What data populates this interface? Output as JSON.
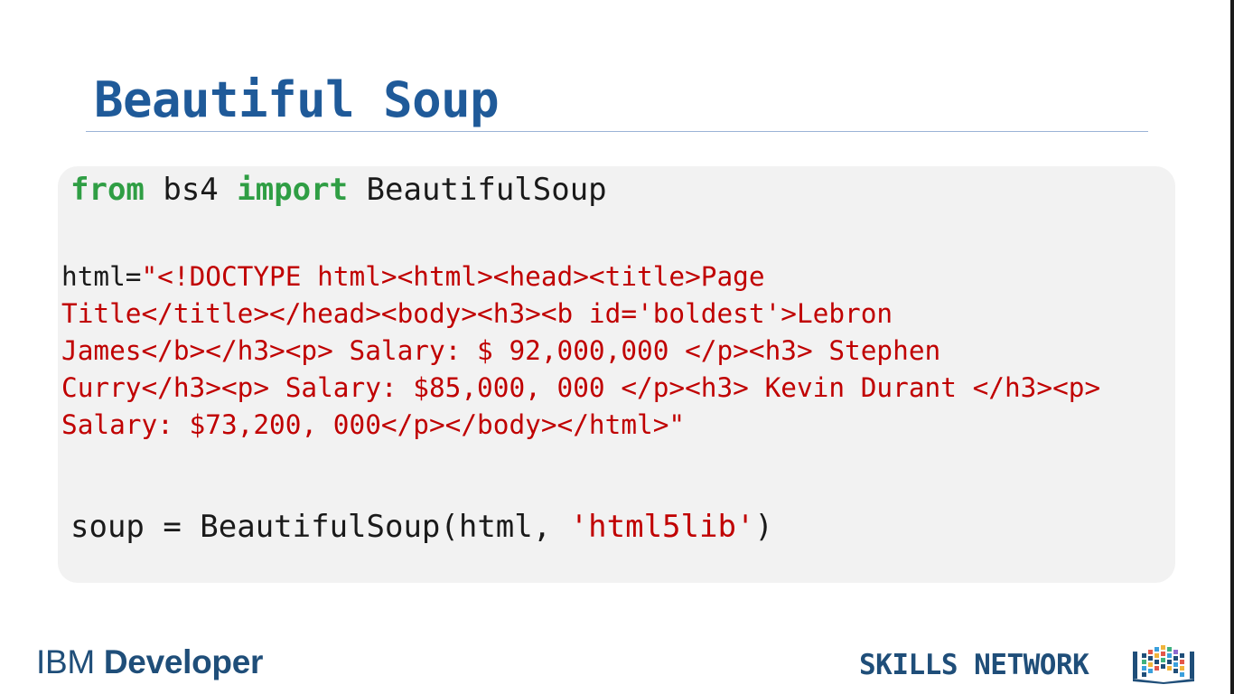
{
  "slide": {
    "title": "Beautiful Soup"
  },
  "code": {
    "import_line": {
      "kw_from": "from",
      "module": " bs4 ",
      "kw_import": "import",
      "name": " BeautifulSoup"
    },
    "html_assignment": {
      "prefix": "html=",
      "lines": [
        "\"<!DOCTYPE html><html><head><title>Page",
        "Title</title></head><body><h3><b id='boldest'>Lebron",
        "James</b></h3><p> Salary: $ 92,000,000 </p><h3> Stephen",
        "Curry</h3><p> Salary: $85,000, 000 </p><h3> Kevin Durant </h3><p>",
        "Salary: $73,200, 000</p></body></html>\""
      ]
    },
    "soup_line": {
      "prefix": "soup = BeautifulSoup(html, ",
      "parser": "'html5lib'",
      "suffix": ")"
    }
  },
  "footer": {
    "ibm_light": "IBM ",
    "ibm_bold": "Developer",
    "skills_network": "SKILLS NETWORK",
    "logo_icon": "skills-network-book-icon"
  },
  "colors": {
    "title": "#1f5a99",
    "keyword": "#2f9e44",
    "string": "#c00000",
    "footer_brand": "#1f4e79"
  }
}
